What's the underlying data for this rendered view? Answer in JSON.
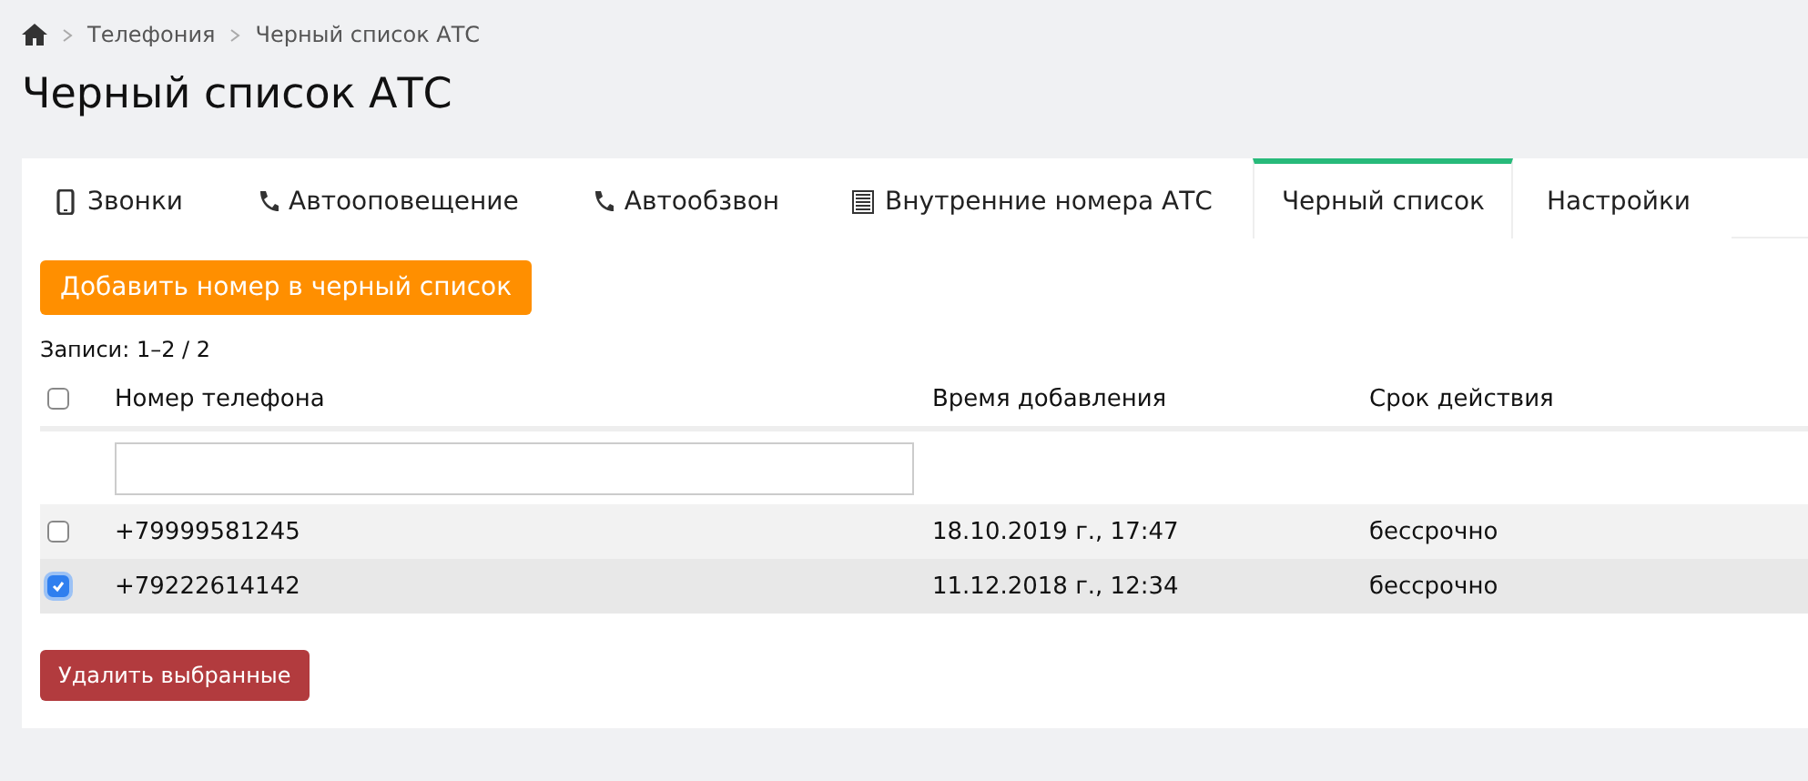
{
  "breadcrumb": [
    "Телефония",
    "Черный список АТС"
  ],
  "title": "Черный список АТС",
  "tabs": [
    {
      "label": "Звонки",
      "kind": "mobile",
      "selected": false
    },
    {
      "label": "Автооповещение",
      "kind": "phone",
      "selected": false
    },
    {
      "label": "Автообзвон",
      "kind": "phone",
      "selected": false
    },
    {
      "label": "Внутренние номера АТС",
      "kind": "list",
      "selected": false
    },
    {
      "label": "Черный список",
      "kind": "plain",
      "selected": true
    },
    {
      "label": "Настройки",
      "kind": "plain",
      "selected": false
    }
  ],
  "add_button": "Добавить номер в черный список",
  "records": "Записи: 1–2 / 2",
  "table": {
    "select_all_checked": false,
    "columns": [
      "Номер телефона",
      "Время добавления",
      "Срок действия"
    ],
    "rows": [
      {
        "checked": false,
        "cells": [
          "+79999581245",
          "18.10.2019 г., 17:47",
          "бессрочно"
        ]
      },
      {
        "checked": true,
        "cells": [
          "+79222614142",
          "11.12.2018 г., 12:34",
          "бессрочно"
        ]
      }
    ]
  },
  "delete_button": "Удалить выбранные"
}
